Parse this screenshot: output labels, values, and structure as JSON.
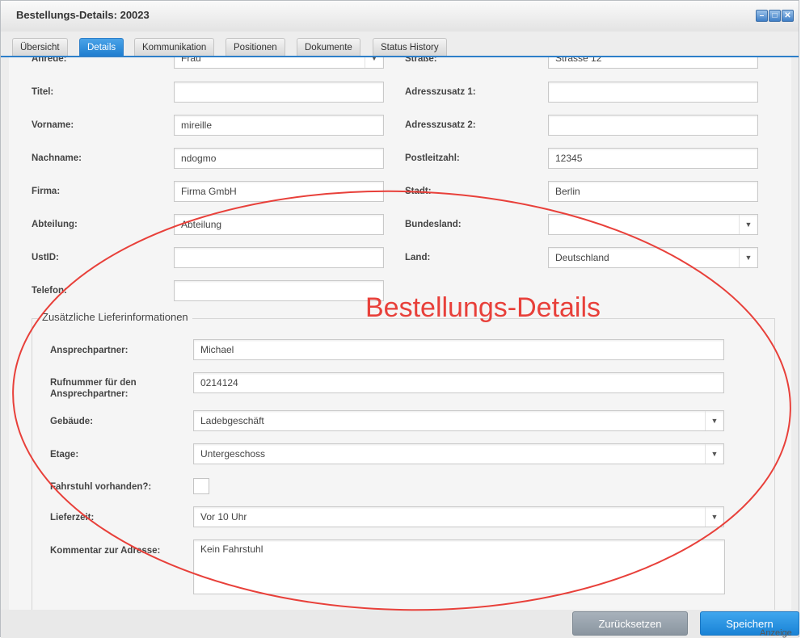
{
  "window": {
    "title": "Bestellungs-Details: 20023",
    "buttons": [
      "–",
      "□",
      "✕"
    ]
  },
  "tabs": [
    {
      "label": "Übersicht",
      "active": false
    },
    {
      "label": "Details",
      "active": true
    },
    {
      "label": "Kommunikation",
      "active": false
    },
    {
      "label": "Positionen",
      "active": false
    },
    {
      "label": "Dokumente",
      "active": false
    },
    {
      "label": "Status History",
      "active": false
    }
  ],
  "left_fields": {
    "anrede": {
      "label": "Anrede:",
      "value": "Frau"
    },
    "titel": {
      "label": "Titel:",
      "value": ""
    },
    "vorname": {
      "label": "Vorname:",
      "value": "mireille"
    },
    "nachname": {
      "label": "Nachname:",
      "value": "ndogmo"
    },
    "firma": {
      "label": "Firma:",
      "value": "Firma GmbH"
    },
    "abteilung": {
      "label": "Abteilung:",
      "value": "Abteilung"
    },
    "ustid": {
      "label": "UstID:",
      "value": ""
    },
    "telefon": {
      "label": "Telefon:",
      "value": ""
    }
  },
  "right_fields": {
    "strasse": {
      "label": "Straße:",
      "value": "Strasse 12"
    },
    "adresszusatz1": {
      "label": "Adresszusatz 1:",
      "value": ""
    },
    "adresszusatz2": {
      "label": "Adresszusatz 2:",
      "value": ""
    },
    "postleitzahl": {
      "label": "Postleitzahl:",
      "value": "12345"
    },
    "stadt": {
      "label": "Stadt:",
      "value": "Berlin"
    },
    "bundesland": {
      "label": "Bundesland:",
      "value": ""
    },
    "land": {
      "label": "Land:",
      "value": "Deutschland"
    }
  },
  "delivery": {
    "legend": "Zusätzliche Lieferinformationen",
    "ansprechpartner": {
      "label": "Ansprechpartner:",
      "value": "Michael"
    },
    "rufnummer": {
      "label_line1": "Rufnummer für den",
      "label_line2": "Ansprechpartner:",
      "value": "0214124"
    },
    "gebaeude": {
      "label": "Gebäude:",
      "value": "Ladebgeschäft"
    },
    "etage": {
      "label": "Etage:",
      "value": "Untergeschoss"
    },
    "fahrstuhl": {
      "label": "Fahrstuhl vorhanden?:",
      "checked": false
    },
    "lieferzeit": {
      "label": "Lieferzeit:",
      "value": "Vor 10 Uhr"
    },
    "kommentar": {
      "label": "Kommentar zur Adresse:",
      "value": "Kein Fahrstuhl"
    }
  },
  "footer": {
    "reset_label": "Zurücksetzen",
    "save_label": "Speichern",
    "cutoff_text": "Anzeige"
  },
  "annotation": {
    "text": "Bestellungs-Details",
    "color": "#e8403a"
  },
  "colors": {
    "accent": "#2d7fc9",
    "save": "#1a83d6"
  }
}
